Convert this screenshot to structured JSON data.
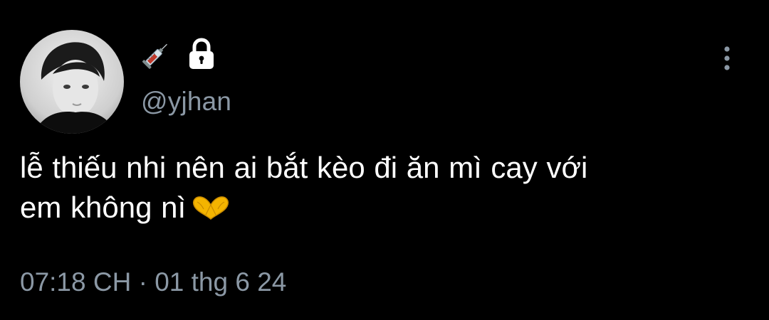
{
  "tweet": {
    "handle": "@yjhan",
    "text_line1": "lễ thiếu nhi nên ai bắt kèo đi ăn mì cay với",
    "text_line2": "em không nì",
    "timestamp": "07:18 CH · 01 thg 6 24"
  },
  "icons": {
    "name_emoji_1": "syringe-icon",
    "name_emoji_2": "lock-icon",
    "menu": "more-vertical-icon",
    "tweet_emoji": "heart-hands-emoji"
  },
  "colors": {
    "background": "#000000",
    "text": "#ffffff",
    "secondary_text": "#8b98a5",
    "heart_hands": "#f4b400"
  }
}
